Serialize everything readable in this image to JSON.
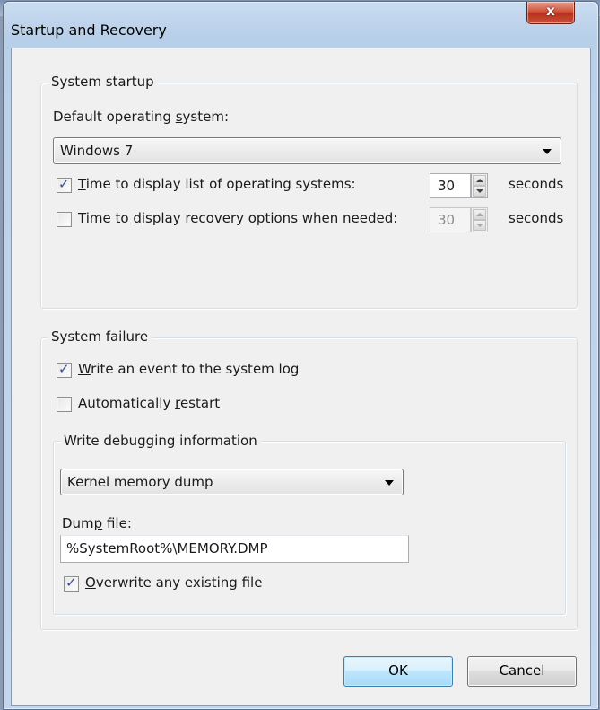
{
  "window": {
    "title": "Startup and Recovery",
    "close_glyph": "x",
    "close_icon": "close-icon"
  },
  "system_startup": {
    "group_label": "System startup",
    "default_os_label": {
      "pre": "Default operating ",
      "accel": "s",
      "post": "ystem:"
    },
    "default_os_value": "Windows 7",
    "display_os_list": {
      "checked": true,
      "label": {
        "pre": "",
        "accel": "T",
        "post": "ime to display list of operating systems:"
      },
      "value": "30",
      "unit": "seconds"
    },
    "display_recovery": {
      "checked": false,
      "label": {
        "pre": "Time to ",
        "accel": "d",
        "post": "isplay recovery options when needed:"
      },
      "value": "30",
      "unit": "seconds",
      "disabled": true
    }
  },
  "system_failure": {
    "group_label": "System failure",
    "write_event": {
      "checked": true,
      "label": {
        "pre": "",
        "accel": "W",
        "post": "rite an event to the system log"
      }
    },
    "auto_restart": {
      "checked": false,
      "label": {
        "pre": "Automatically ",
        "accel": "r",
        "post": "estart"
      }
    },
    "debug_group_label": "Write debugging information",
    "debug_type_value": "Kernel memory dump",
    "dump_file_label": {
      "pre": "Dum",
      "accel": "p",
      "post": " file:"
    },
    "dump_file_value": "%SystemRoot%\\MEMORY.DMP",
    "overwrite": {
      "checked": true,
      "label": {
        "pre": "",
        "accel": "O",
        "post": "verwrite any existing file"
      }
    }
  },
  "buttons": {
    "ok": "OK",
    "cancel": "Cancel"
  },
  "check_glyph": "✓"
}
